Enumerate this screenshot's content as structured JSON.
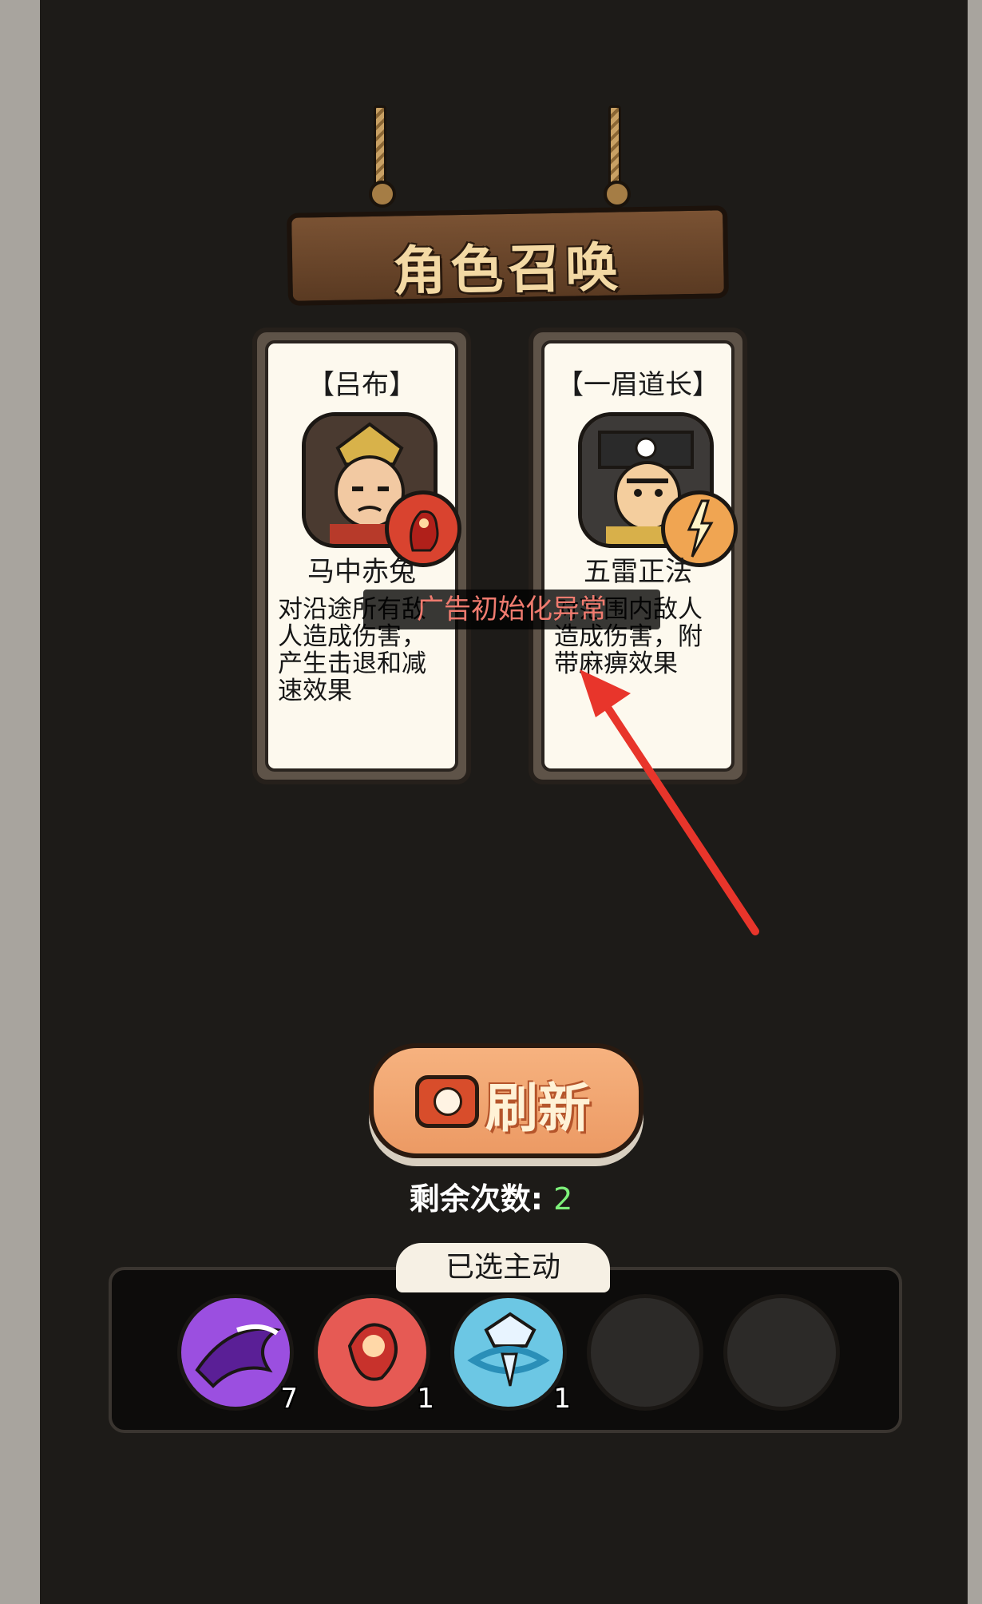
{
  "header": {
    "title": "角色召唤"
  },
  "cards": [
    {
      "name": "【吕布】",
      "skill": "马中赤兔",
      "description": "对沿途所有敌人造成伤害，产生击退和减速效果"
    },
    {
      "name": "【一眉道长】",
      "skill": "五雷正法",
      "description": "对范围内敌人造成伤害，附带麻痹效果"
    }
  ],
  "toast": {
    "message": "广告初始化异常"
  },
  "refresh": {
    "label": "刷新",
    "remaining_label": "剩余次数:",
    "remaining_value": "2"
  },
  "selected": {
    "tab_label": "已选主动",
    "slots": [
      {
        "icon": "purple-claw-icon",
        "count": "7"
      },
      {
        "icon": "red-fireball-icon",
        "count": "1"
      },
      {
        "icon": "blue-spike-spin-icon",
        "count": "1"
      },
      {
        "icon": "empty-slot",
        "count": ""
      },
      {
        "icon": "empty-slot",
        "count": ""
      }
    ]
  },
  "colors": {
    "toast_text": "#f07b6f",
    "remaining_value": "#7df07a",
    "button": "#ec9a64"
  }
}
